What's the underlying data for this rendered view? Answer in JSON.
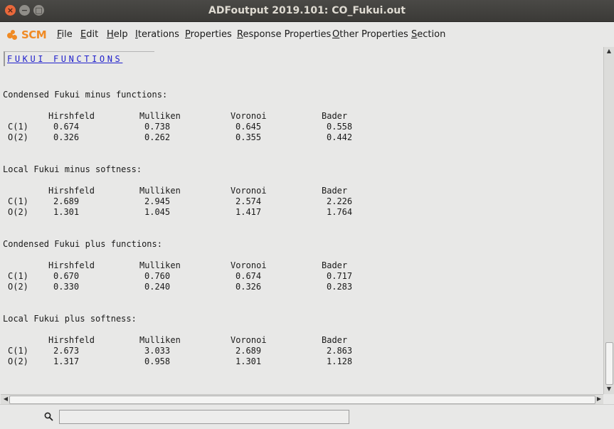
{
  "window": {
    "title": "ADFoutput 2019.101: CO_Fukui.out",
    "close_glyph": "×",
    "min_glyph": "−",
    "max_glyph": "□"
  },
  "logo": {
    "text": "SCM",
    "color": "#f08a24"
  },
  "menu": [
    {
      "label": "File",
      "mnemonic": "F",
      "rest": "ile"
    },
    {
      "label": "Edit",
      "mnemonic": "E",
      "rest": "dit"
    },
    {
      "label": "Help",
      "mnemonic": "H",
      "rest": "elp"
    },
    {
      "label": "Iterations",
      "mnemonic": "I",
      "rest": "terations"
    },
    {
      "label": "Properties",
      "mnemonic": "P",
      "rest": "roperties"
    },
    {
      "label": "Response Properties",
      "mnemonic": "R",
      "rest": "esponse Properties"
    },
    {
      "label": "Other Properties",
      "mnemonic": "O",
      "rest": "ther Properties"
    },
    {
      "label": "Section",
      "mnemonic": "S",
      "rest": "ection"
    }
  ],
  "content": {
    "header_link": "FUKUI FUNCTIONS",
    "columns": [
      "Hirshfeld",
      "Mulliken",
      "Voronoi",
      "Bader"
    ],
    "sections": [
      {
        "title": "Condensed Fukui minus functions:",
        "rows": [
          {
            "atom": "C(1)",
            "values": [
              "0.674",
              "0.738",
              "0.645",
              "0.558"
            ]
          },
          {
            "atom": "O(2)",
            "values": [
              "0.326",
              "0.262",
              "0.355",
              "0.442"
            ]
          }
        ]
      },
      {
        "title": "Local Fukui minus softness:",
        "rows": [
          {
            "atom": "C(1)",
            "values": [
              "2.689",
              "2.945",
              "2.574",
              "2.226"
            ]
          },
          {
            "atom": "O(2)",
            "values": [
              "1.301",
              "1.045",
              "1.417",
              "1.764"
            ]
          }
        ]
      },
      {
        "title": "Condensed Fukui plus functions:",
        "rows": [
          {
            "atom": "C(1)",
            "values": [
              "0.670",
              "0.760",
              "0.674",
              "0.717"
            ]
          },
          {
            "atom": "O(2)",
            "values": [
              "0.330",
              "0.240",
              "0.326",
              "0.283"
            ]
          }
        ]
      },
      {
        "title": "Local Fukui plus softness:",
        "rows": [
          {
            "atom": "C(1)",
            "values": [
              "2.673",
              "3.033",
              "2.689",
              "2.863"
            ]
          },
          {
            "atom": "O(2)",
            "values": [
              "1.317",
              "0.958",
              "1.301",
              "1.128"
            ]
          }
        ]
      }
    ]
  },
  "scrollbars": {
    "up": "▲",
    "down": "▼",
    "left": "◀",
    "right": "▶"
  },
  "search": {
    "value": "",
    "placeholder": ""
  }
}
